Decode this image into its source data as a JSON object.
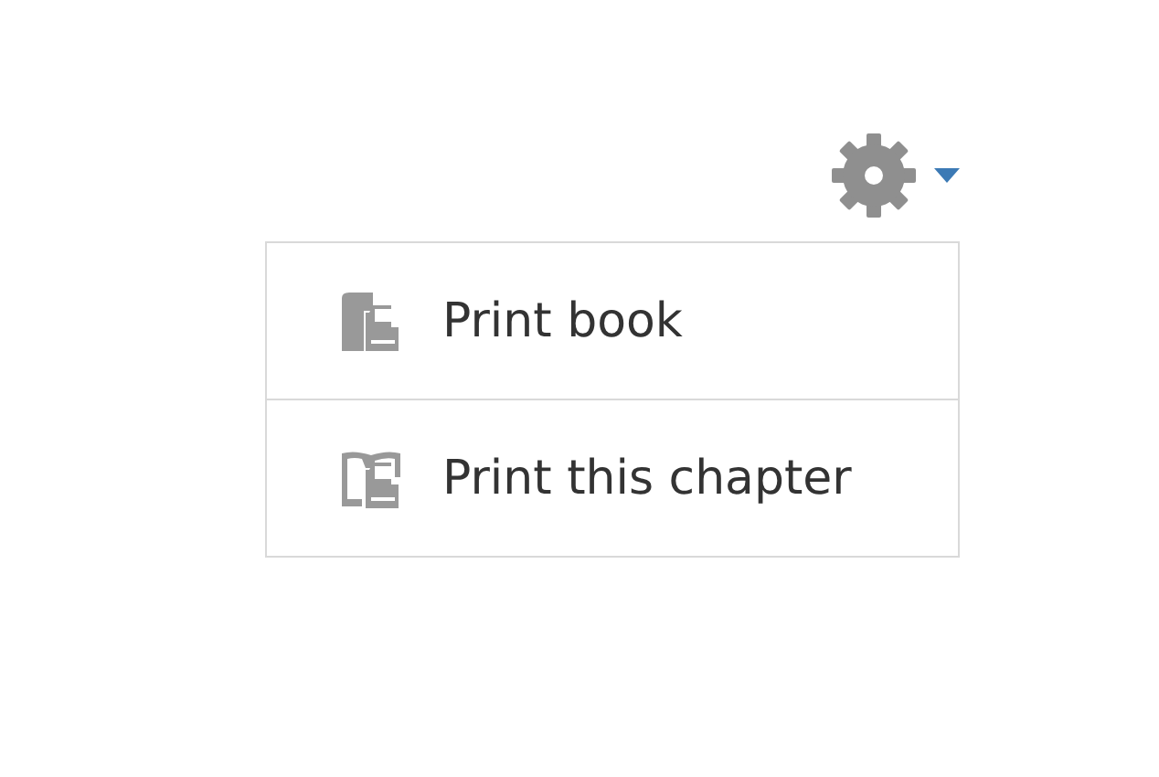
{
  "menu": {
    "items": [
      {
        "kind": "book",
        "label": "Print book"
      },
      {
        "kind": "chapter",
        "label": "Print this chapter"
      }
    ]
  }
}
